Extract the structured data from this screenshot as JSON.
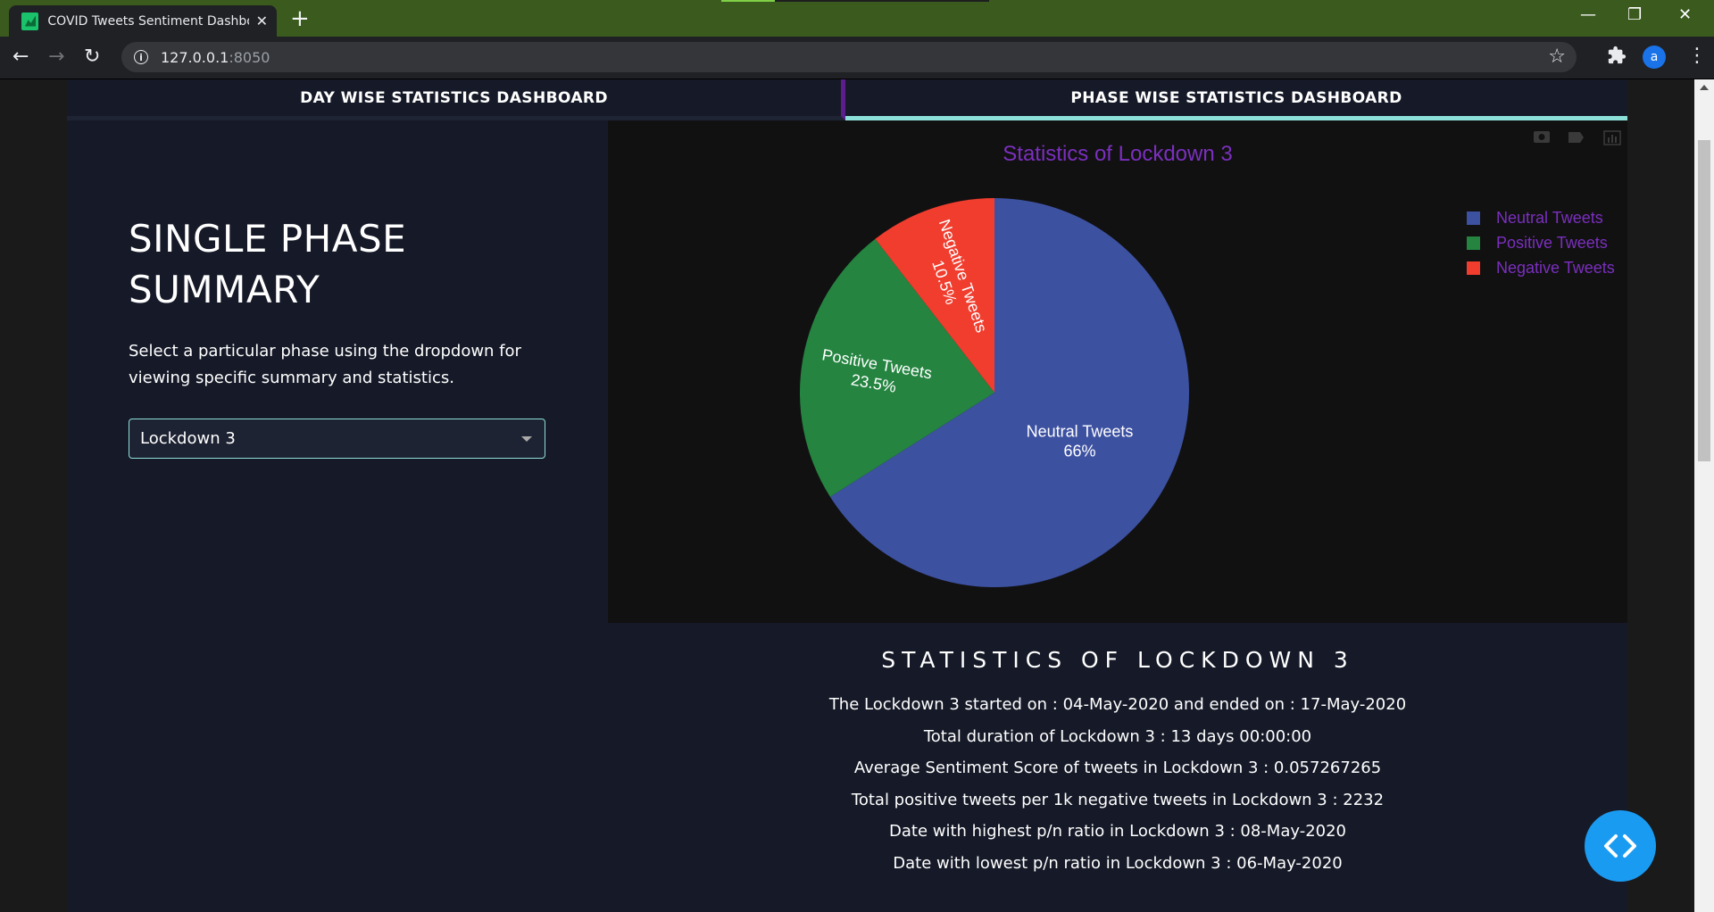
{
  "browser": {
    "tab_title": "COVID Tweets Sentiment Dashboard",
    "url_host": "127.0.0.1",
    "url_port": ":8050",
    "profile_initial": "a"
  },
  "tabs": {
    "day": "DAY WISE STATISTICS DASHBOARD",
    "phase": "PHASE WISE STATISTICS DASHBOARD"
  },
  "summary": {
    "heading_line1": "SINGLE PHASE",
    "heading_line2": "SUMMARY",
    "desc_line1": "Select a particular phase using the dropdown for",
    "desc_line2": "viewing specific summary and statistics.",
    "dropdown_value": "Lockdown 3"
  },
  "chart_data": {
    "type": "pie",
    "title": "Statistics of Lockdown 3",
    "labels": [
      "Neutral Tweets",
      "Positive Tweets",
      "Negative Tweets"
    ],
    "values": [
      66,
      23.5,
      10.5
    ],
    "colors": [
      "#3d51a1",
      "#248440",
      "#f03d2e"
    ],
    "legend_position": "top-right",
    "title_color": "#7b2fbf"
  },
  "stats": {
    "title": "STATISTICS OF LOCKDOWN 3",
    "lines": [
      "The Lockdown 3 started on : 04-May-2020 and ended on : 17-May-2020",
      "Total duration of Lockdown 3 : 13 days 00:00:00",
      "Average Sentiment Score of tweets in Lockdown 3 : 0.057267265",
      "Total positive tweets per 1k negative tweets in Lockdown 3 : 2232",
      "Date with highest p/n ratio in Lockdown 3 : 08-May-2020",
      "Date with lowest p/n ratio in Lockdown 3 : 06-May-2020"
    ]
  }
}
